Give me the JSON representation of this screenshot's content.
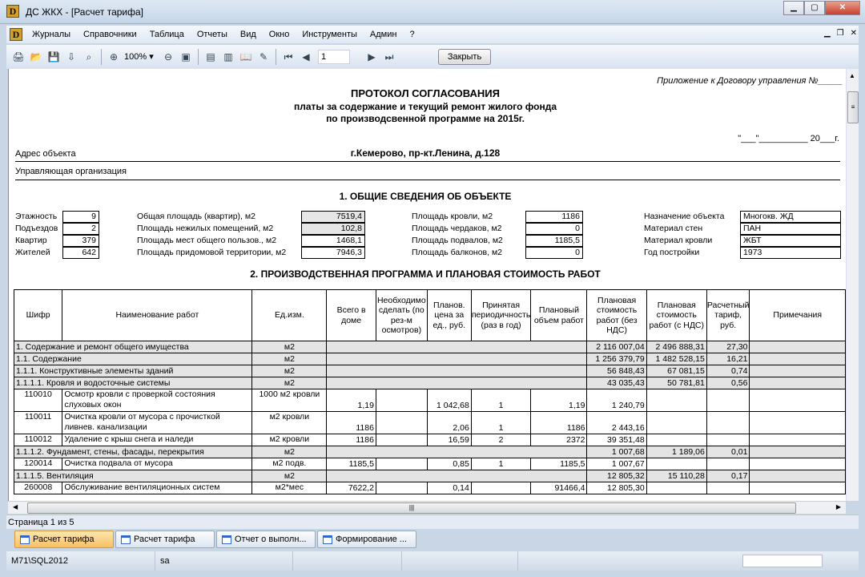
{
  "window": {
    "title": "ДС ЖКХ - [Расчет тарифа]",
    "logo": "D",
    "controls": {
      "minimize": "▁",
      "maximize": "▢",
      "close": "✕"
    }
  },
  "menu": [
    "Журналы",
    "Справочники",
    "Таблица",
    "Отчеты",
    "Вид",
    "Окно",
    "Инструменты",
    "Админ",
    "?"
  ],
  "mdi_controls": {
    "minimize": "▁",
    "restore": "❐",
    "close": "✕"
  },
  "toolbar": {
    "zoom": "100%",
    "page": "1",
    "close_label": "Закрыть"
  },
  "report": {
    "appendix": "Приложение к Договору управления №_____",
    "title1": "ПРОТОКОЛ СОГЛАСОВАНИЯ",
    "title2": "платы за содержание и текущий ремонт жилого фонда",
    "title3": "по производсвенной программе на 2015г.",
    "date_line": "\"___\"__________ 20___г.",
    "address_label": "Адрес объекта",
    "address": "г.Кемерово, пр-кт.Ленина, д.128",
    "org_label": "Управляющая организация",
    "section1": "1. ОБЩИЕ СВЕДЕНИЯ ОБ ОБЪЕКТЕ",
    "section2": "2. ПРОИЗВОДСТВЕННАЯ ПРОГРАММА И ПЛАНОВАЯ СТОИМОСТЬ РАБОТ",
    "col1": [
      {
        "label": "Этажность",
        "value": "9"
      },
      {
        "label": "Подъездов",
        "value": "2"
      },
      {
        "label": "Квартир",
        "value": "379"
      },
      {
        "label": "Жителей",
        "value": "642"
      }
    ],
    "col2": [
      {
        "label": "Общая площадь (квартир), м2",
        "value": "7519,4"
      },
      {
        "label": "Площадь нежилых помещений, м2",
        "value": "102,8"
      },
      {
        "label": "Площадь мест общего пользов., м2",
        "value": "1468,1"
      },
      {
        "label": "Площадь придомовой территории, м2",
        "value": "7946,3"
      }
    ],
    "col3": [
      {
        "label": "Площадь кровли, м2",
        "value": "1186"
      },
      {
        "label": "Площадь чердаков, м2",
        "value": "0"
      },
      {
        "label": "Площадь подвалов, м2",
        "value": "1185,5"
      },
      {
        "label": "Площадь балконов, м2",
        "value": "0"
      }
    ],
    "col4": [
      {
        "label": "Назначение объекта",
        "value": "Многокв. ЖД"
      },
      {
        "label": "Материал стен",
        "value": "ПАН"
      },
      {
        "label": "Материал кровли",
        "value": "ЖБТ"
      },
      {
        "label": "Год постройки",
        "value": "1973"
      }
    ]
  },
  "table": {
    "headers": [
      "Шифр",
      "Наименование работ",
      "Ед.изм.",
      "Всего в доме",
      "Необходимо сделать (по рез-м осмотров)",
      "Планов. цена за ед., руб.",
      "Принятая периодичность (раз в год)",
      "Плановый объем работ",
      "Плановая стоимость работ (без НДС)",
      "Плановая стоимость работ (с НДС)",
      "Расчетный тариф, руб.",
      "Примечания"
    ],
    "rows": [
      {
        "type": "group",
        "name": "1. Содержание и ремонт общего имущества",
        "unit": "м2",
        "cost": "2 116 007,04",
        "cost_vat": "2 496 888,31",
        "tariff": "27,30"
      },
      {
        "type": "group",
        "name": "1.1. Содержание",
        "unit": "м2",
        "cost": "1 256 379,79",
        "cost_vat": "1 482 528,15",
        "tariff": "16,21"
      },
      {
        "type": "group",
        "name": "1.1.1. Конструктивные элементы зданий",
        "unit": "м2",
        "cost": "56 848,43",
        "cost_vat": "67 081,15",
        "tariff": "0,74"
      },
      {
        "type": "group",
        "name": "1.1.1.1. Кровля и водосточные системы",
        "unit": "м2",
        "cost": "43 035,43",
        "cost_vat": "50 781,81",
        "tariff": "0,56"
      },
      {
        "type": "item",
        "code": "110010",
        "name": "Осмотр кровли с проверкой состояния слуховых окон",
        "unit": "1000 м2 кровли",
        "total": "1,19",
        "need": "",
        "price": "1 042,68",
        "period": "1",
        "volume": "1,19",
        "cost": "1 240,79",
        "cost_vat": "",
        "tariff": ""
      },
      {
        "type": "item",
        "code": "110011",
        "name": "Очистка кровли от мусора с прочисткой ливнев. канализации",
        "unit": "м2 кровли",
        "total": "1186",
        "need": "",
        "price": "2,06",
        "period": "1",
        "volume": "1186",
        "cost": "2 443,16",
        "cost_vat": "",
        "tariff": ""
      },
      {
        "type": "item",
        "code": "110012",
        "name": "Удаление с крыш снега и наледи",
        "unit": "м2 кровли",
        "total": "1186",
        "need": "",
        "price": "16,59",
        "period": "2",
        "volume": "2372",
        "cost": "39 351,48",
        "cost_vat": "",
        "tariff": ""
      },
      {
        "type": "group",
        "name": "1.1.1.2. Фундамент, стены, фасады, перекрытия",
        "unit": "м2",
        "cost": "1 007,68",
        "cost_vat": "1 189,06",
        "tariff": "0,01"
      },
      {
        "type": "item",
        "code": "120014",
        "name": "Очистка подвала от мусора",
        "unit": "м2 подв.",
        "total": "1185,5",
        "need": "",
        "price": "0,85",
        "period": "1",
        "volume": "1185,5",
        "cost": "1 007,67",
        "cost_vat": "",
        "tariff": ""
      },
      {
        "type": "group",
        "name": "1.1.1.5. Вентиляция",
        "unit": "м2",
        "cost": "12 805,32",
        "cost_vat": "15 110,28",
        "tariff": "0,17"
      },
      {
        "type": "item",
        "code": "260008",
        "name": "Обслуживание вентиляционных систем",
        "unit": "м2*мес",
        "total": "7622,2",
        "need": "",
        "price": "0,14",
        "period": "",
        "volume": "91466,4",
        "cost": "12 805,30",
        "cost_vat": "",
        "tariff": ""
      }
    ]
  },
  "status": {
    "page": "Страница 1 из 5",
    "server": "M71\\SQL2012",
    "user": "sa"
  },
  "tabs": [
    "Расчет тарифа",
    "Расчет тарифа",
    "Отчет о выполн...",
    "Формирование ..."
  ]
}
